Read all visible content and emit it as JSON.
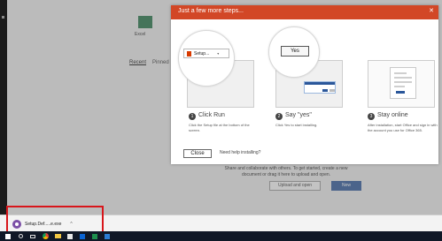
{
  "dialog": {
    "title": "Just a few more steps...",
    "close_icon": "close-icon",
    "setup_chip_text": "Setup...",
    "yes_label": "Yes",
    "steps": [
      {
        "number": "1",
        "title": "Click Run",
        "description": "Click the Setup file at the bottom of the screen."
      },
      {
        "number": "2",
        "title": "Say \"yes\"",
        "description": "Click Yes to start installing."
      },
      {
        "number": "3",
        "title": "Stay online",
        "description": "After installation, start Office and sign in with the account you use for Office 365."
      }
    ],
    "close_label": "Close",
    "help_text": "Need help installing?"
  },
  "background": {
    "app_label": "Excel",
    "tabs": [
      "Recent",
      "Pinned"
    ],
    "hint_text": "Share and collaborate with others. To get started, create a new document or drag it here to upload and open.",
    "upload_label": "Upload and open",
    "new_label": "New"
  },
  "download_bar": {
    "filename": "Setup.Def.....e.exe",
    "caret": "^"
  },
  "colors": {
    "header": "#d24726",
    "highlight": "#d8161b",
    "taskbar": "#101827"
  },
  "taskbar": {
    "icons": [
      "windows-icon",
      "search-icon",
      "task-view-icon",
      "chrome-icon",
      "file-explorer-icon",
      "store-icon",
      "outlook-icon",
      "excel-icon",
      "word-icon"
    ]
  }
}
